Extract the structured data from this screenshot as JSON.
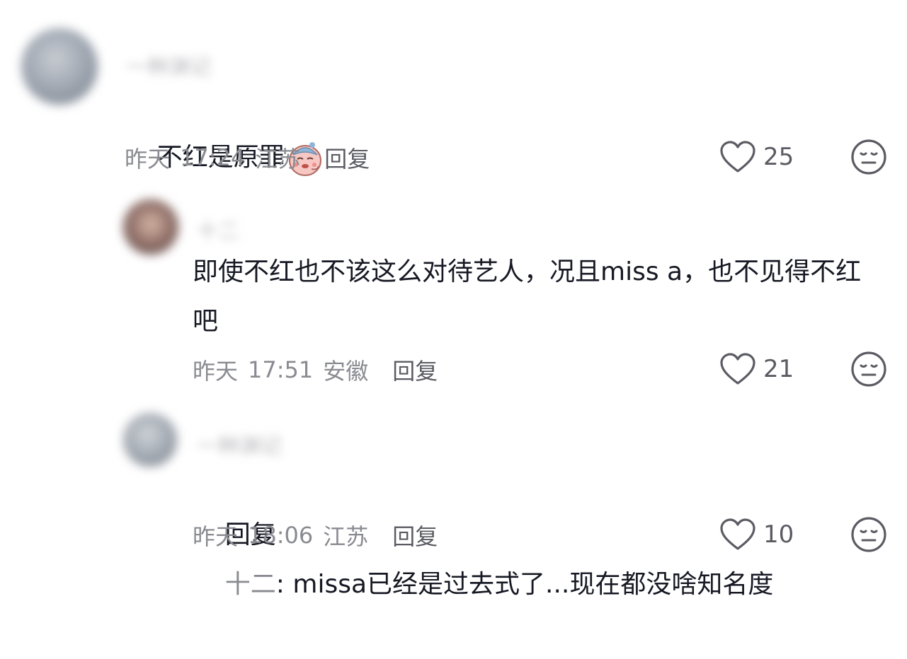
{
  "comments": [
    {
      "username": "一种渊记",
      "text": "不红是原罪",
      "emoji": "sad-face-emoji",
      "date": "昨天",
      "time": "17:24",
      "location": "江苏",
      "reply_label": "回复",
      "likes": "25"
    },
    {
      "username": "十二",
      "text": "即使不红也不该这么对待艺人，况且miss a，也不见得不红吧",
      "date": "昨天",
      "time": "17:51",
      "location": "安徽",
      "reply_label": "回复",
      "likes": "21"
    },
    {
      "username": "一种渊记",
      "reply_prefix": "回复",
      "reply_target": "十二",
      "text": ": missa已经是过去式了...现在都没啥知名度",
      "date": "昨天",
      "time": "18:06",
      "location": "江苏",
      "reply_label": "回复",
      "likes": "10"
    }
  ],
  "icons": {
    "like": "heart-outline-icon",
    "dislike": "meh-face-icon"
  },
  "colors": {
    "text": "#161823",
    "meta": "#8a8b91",
    "icon": "#5b5c63"
  }
}
